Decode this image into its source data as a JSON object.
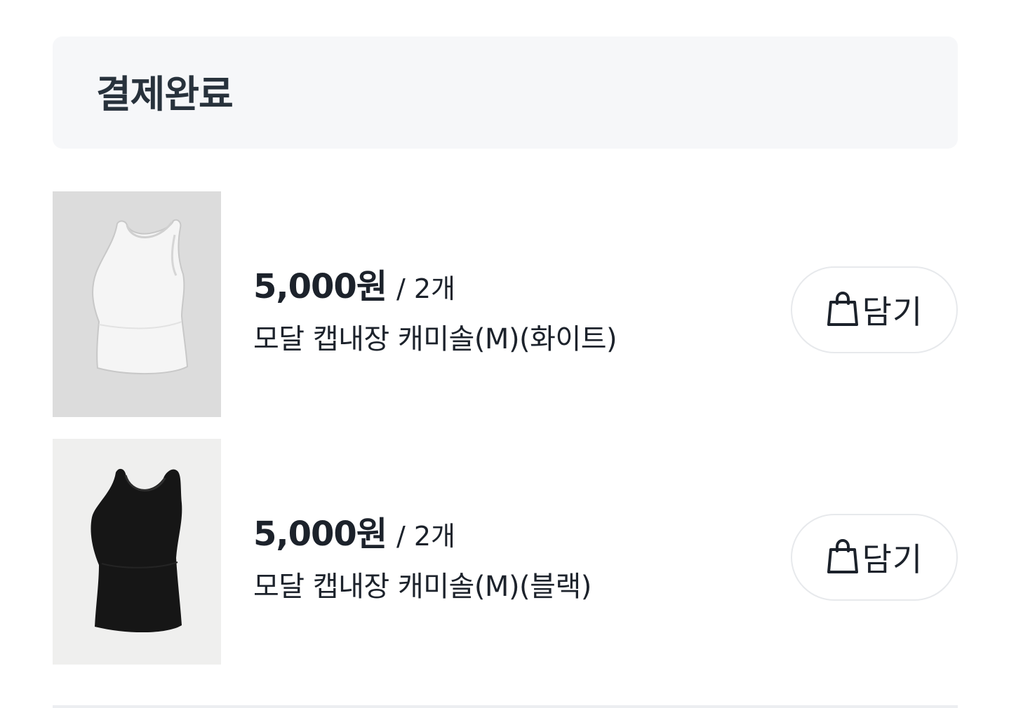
{
  "header": {
    "title": "결제완료"
  },
  "items": [
    {
      "price": "5,000원",
      "quantity": "/ 2개",
      "name": "모달 캡내장 캐미솔(M)(화이트)",
      "cart_label": "담기",
      "cart_icon": "shopping-bag-icon",
      "image": "white-camisole",
      "image_bg_color": "#dcdcdc",
      "garment_color": "#f5f5f5"
    },
    {
      "price": "5,000원",
      "quantity": "/ 2개",
      "name": "모달 캡내장 캐미솔(M)(블랙)",
      "cart_label": "담기",
      "cart_icon": "shopping-bag-icon",
      "image": "black-camisole",
      "image_bg_color": "#efefee",
      "garment_color": "#161616"
    }
  ]
}
